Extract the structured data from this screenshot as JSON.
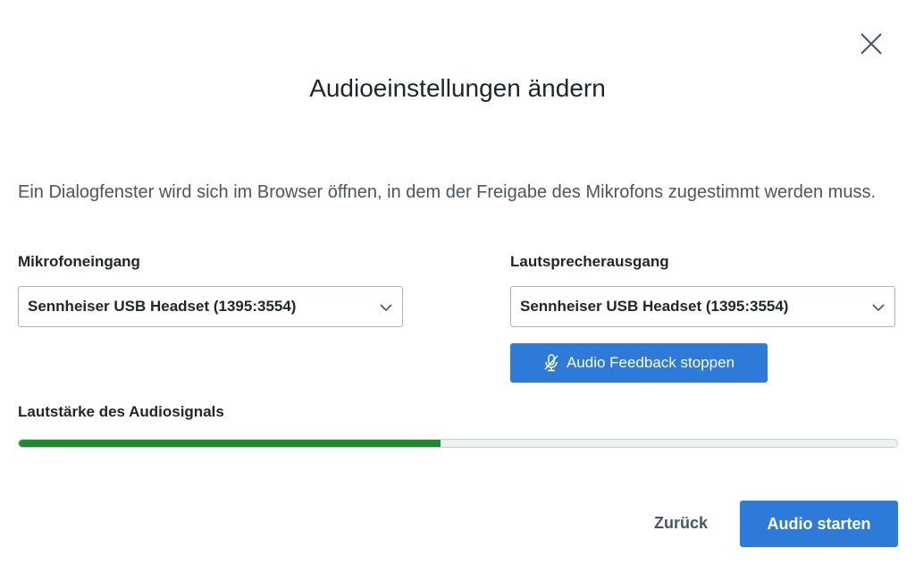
{
  "dialog": {
    "title": "Audioeinstellungen ändern",
    "info_text": "Ein Dialogfenster wird sich im Browser öffnen, in dem der Freigabe des Mikrofons zugestimmt werden muss."
  },
  "microphone": {
    "label": "Mikrofoneingang",
    "selected": "Sennheiser USB Headset (1395:3554)"
  },
  "speaker": {
    "label": "Lautsprecherausgang",
    "selected": "Sennheiser USB Headset (1395:3554)"
  },
  "feedback_button": {
    "label": "Audio Feedback stoppen",
    "icon": "mic-off-icon"
  },
  "volume": {
    "label": "Lautstärke des Audiosignals",
    "level_percent": 48
  },
  "footer": {
    "back_label": "Zurück",
    "start_label": "Audio starten"
  },
  "colors": {
    "primary": "#2d7ad8",
    "meter_fill": "#1e8a2e"
  }
}
